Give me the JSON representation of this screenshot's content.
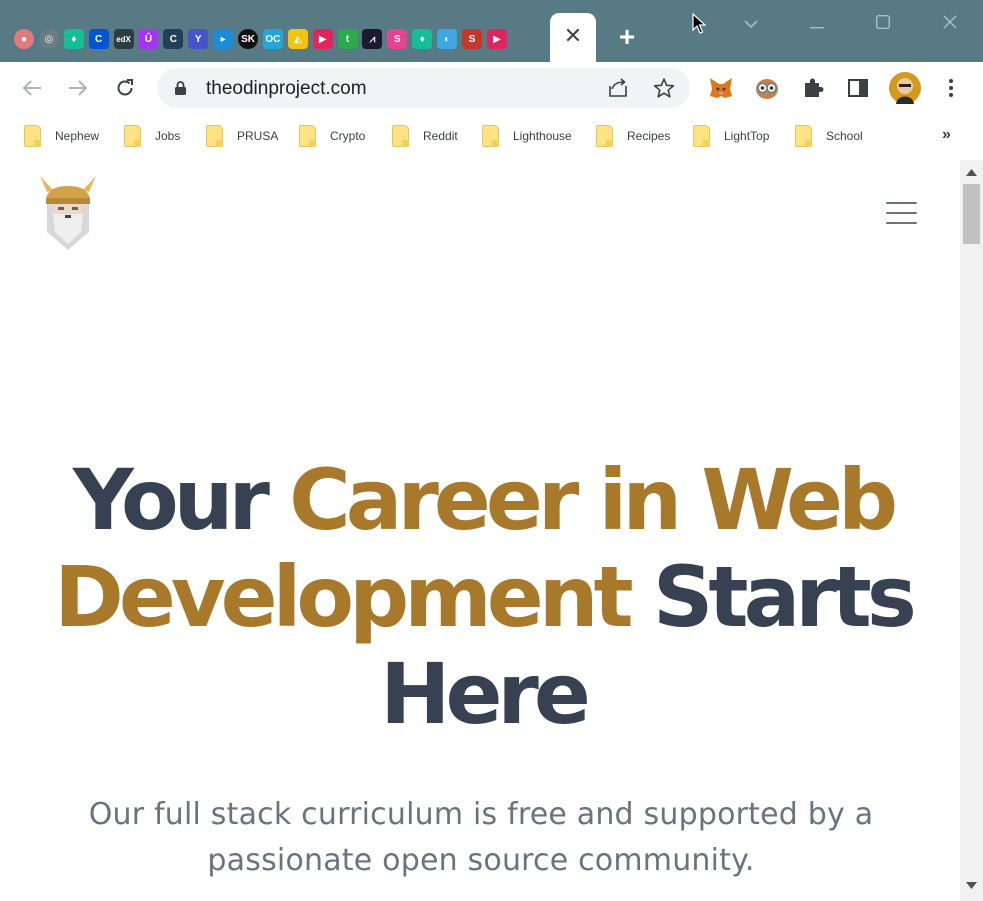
{
  "browser": {
    "tab_favicons": [
      {
        "icon": "record-icon",
        "bg": "#e07b7b",
        "glyph": "●"
      },
      {
        "icon": "chrome-outline-icon",
        "bg": "#6b7d84",
        "glyph": "◎"
      },
      {
        "icon": "khan-academy-icon",
        "bg": "#14bf96",
        "glyph": "♦"
      },
      {
        "icon": "coursera-icon",
        "bg": "#0056d2",
        "glyph": "C"
      },
      {
        "icon": "edx-icon",
        "bg": "#2d3b42",
        "glyph": "edX"
      },
      {
        "icon": "udemy-icon",
        "bg": "#a435f0",
        "glyph": "Û"
      },
      {
        "icon": "codecademy-icon",
        "bg": "#1f4056",
        "glyph": "C"
      },
      {
        "icon": "yale-icon",
        "bg": "#4455cc",
        "glyph": "Y"
      },
      {
        "icon": "play-icon",
        "bg": "#1a8cd8",
        "glyph": "▸"
      },
      {
        "icon": "skillshare-icon",
        "bg": "#111111",
        "glyph": "SK"
      },
      {
        "icon": "oc-icon",
        "bg": "#21a7d8",
        "glyph": "OC"
      },
      {
        "icon": "colorful-triangle-icon",
        "bg": "#f1c40f",
        "glyph": "◭"
      },
      {
        "icon": "red-play-icon",
        "bg": "#e0245e",
        "glyph": "▶"
      },
      {
        "icon": "green-t-icon",
        "bg": "#2eaa4e",
        "glyph": "t"
      },
      {
        "icon": "flame-icon",
        "bg": "#1b1b2f",
        "glyph": "⩘"
      },
      {
        "icon": "swirl-icon",
        "bg": "#e84393",
        "glyph": "S"
      },
      {
        "icon": "khan-academy-icon-2",
        "bg": "#14bf96",
        "glyph": "♦"
      },
      {
        "icon": "globe-icon",
        "bg": "#3fa7e0",
        "glyph": "◐"
      },
      {
        "icon": "spiral-icon",
        "bg": "#c0392b",
        "glyph": "S"
      },
      {
        "icon": "red-play-icon-2",
        "bg": "#e0245e",
        "glyph": "▶"
      }
    ],
    "active_tab_close": "✕",
    "new_tab": "+",
    "url": "theodinproject.com",
    "bookmarks": [
      "Nephew",
      "Jobs",
      "PRUSA",
      "Crypto",
      "Reddit",
      "Lighthouse",
      "Recipes",
      "LightTop",
      "School"
    ],
    "bookmarks_overflow": "»",
    "colors": {
      "titlebar": "#577a85",
      "omnibox": "#f1f3f4",
      "folder": "#ffe382"
    }
  },
  "page": {
    "hero": {
      "part1": "Your ",
      "part2": "Career in Web Development",
      "part3": " Starts Here"
    },
    "subtitle": "Our full stack curriculum is free and supported by a passionate open source community.",
    "colors": {
      "heading": "#374151",
      "accent": "#a9792b",
      "subtitle": "#6b7280"
    }
  }
}
